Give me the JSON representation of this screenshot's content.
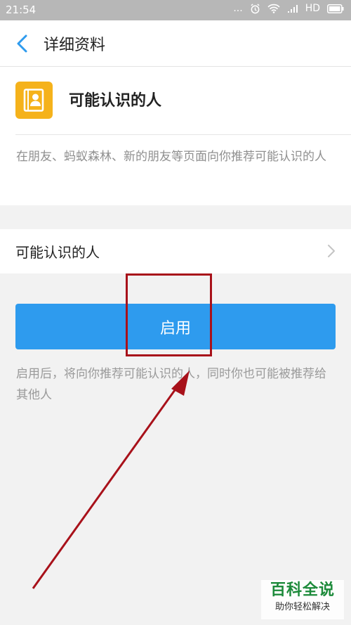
{
  "status_bar": {
    "time": "21:54",
    "dots": "...",
    "network": "HD",
    "icons": [
      "alarm-icon",
      "wifi-icon",
      "signal-icon",
      "battery-icon"
    ]
  },
  "nav": {
    "title": "详细资料",
    "back_icon": "chevron-left-icon",
    "accent_color": "#2e9bee"
  },
  "profile": {
    "icon": "contacts-book-icon",
    "icon_color": "#f5b21b",
    "name": "可能认识的人",
    "description": "在朋友、蚂蚁森林、新的朋友等页面向你推荐可能认识的人"
  },
  "setting_row": {
    "label": "可能认识的人",
    "chevron_icon": "chevron-right-icon"
  },
  "enable": {
    "button_label": "启用",
    "button_color": "#2e9bee",
    "note": "启用后，将向你推荐可能认识的人，同时你也可能被推荐给其他人"
  },
  "annotation": {
    "color": "#a8111a"
  },
  "watermark": {
    "title": "百科全说",
    "subtitle": "助你轻松解决"
  }
}
